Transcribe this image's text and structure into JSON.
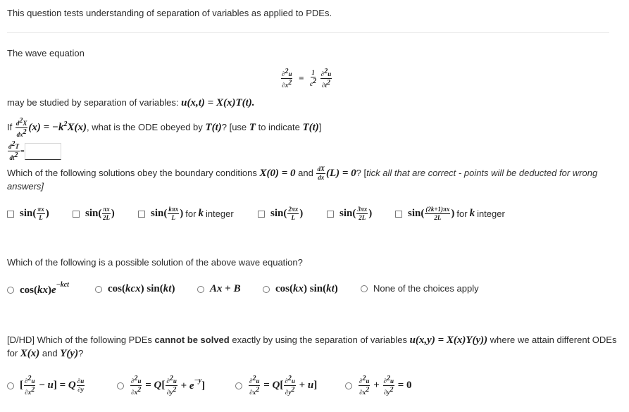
{
  "intro": "This question tests understanding of separation of variables as applied to PDEs.",
  "section1": {
    "label": "The wave equation",
    "equation": "∂²u/∂x² = (1/c²) ∂²u/∂t²",
    "separation_text": "may be studied by separation of variables:",
    "separation_math": "u(x,t) = X(x)T(t).",
    "q1_prefix": "If",
    "q1_math": "d²X/dx² (x) = −k²X(x)",
    "q1_text": ", what is the ODE obeyed by",
    "q1_T": "T(t)",
    "q1_hint_prefix": "? [use",
    "q1_hint_T": "T",
    "q1_hint_mid": "to indicate",
    "q1_hint_Tt": "T(t)",
    "q1_hint_suffix": "]",
    "answer_lhs": "d²T/dt²",
    "answer_value": ""
  },
  "section2": {
    "question_prefix": "Which of the following solutions obey the boundary conditions",
    "cond1": "X(0) = 0",
    "and": "and",
    "cond2": "dX/dx (L) = 0",
    "question_suffix": "? [",
    "note": "tick all that are correct - points will be deducted for wrong answers",
    "note_end": "]",
    "options": [
      {
        "label": "sin(πx/L)",
        "checked": false
      },
      {
        "label": "sin(πx/2L)",
        "checked": false
      },
      {
        "label": "sin(kπx/L) for k integer",
        "checked": false
      },
      {
        "label": "sin(2πx/L)",
        "checked": false
      },
      {
        "label": "sin(3πx/2L)",
        "checked": false
      },
      {
        "label": "sin((2k+1)πx/2L) for k integer",
        "checked": false
      }
    ],
    "for_k_integer": "for",
    "k": "k",
    "integer": "integer"
  },
  "section3": {
    "question": "Which of the following is a possible solution of the above wave equation?",
    "options": [
      {
        "label": "cos(kx)e^(−kct)",
        "selected": false
      },
      {
        "label": "cos(kcx)sin(kt)",
        "selected": false
      },
      {
        "label": "Ax + B",
        "selected": false
      },
      {
        "label": "cos(kx)sin(kt)",
        "selected": false
      },
      {
        "label": "None of the choices apply",
        "selected": false
      }
    ]
  },
  "section4": {
    "prefix": "[D/HD] Which of the following PDEs",
    "bold": "cannot be solved",
    "mid": "exactly by using the separation of variables",
    "math": "u(x,y) = X(x)Y(y))",
    "suffix": "where we attain different ODEs",
    "line2_prefix": "for",
    "line2_X": "X(x)",
    "line2_and": "and",
    "line2_Y": "Y(y)",
    "line2_end": "?",
    "options": [
      {
        "label": "[∂²u/∂x² − u] = Q ∂u/∂y",
        "selected": false
      },
      {
        "label": "∂²u/∂x² = Q[∂²u/∂y² + e^(−y)]",
        "selected": false
      },
      {
        "label": "∂²u/∂x² = Q[∂²u/∂y² + u]",
        "selected": false
      },
      {
        "label": "∂²u/∂x² + ∂²u/∂y² = 0",
        "selected": false
      }
    ]
  }
}
